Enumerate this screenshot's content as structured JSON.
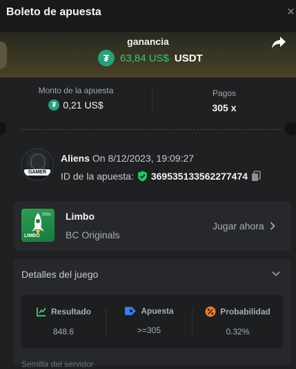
{
  "header": {
    "title": "Boleto de apuesta",
    "close_symbol": "×"
  },
  "hero": {
    "label": "ganancia",
    "amount": "63,84 US$",
    "currency": "USDT",
    "coin_color": "#26a17b",
    "amount_color": "#2fc97b"
  },
  "stats": {
    "bet_amount_label": "Monto de la apuesta",
    "bet_amount_value": "0,21 US$",
    "payout_label": "Pagos",
    "payout_value": "305 x"
  },
  "player": {
    "name": "Aliens",
    "date": "On 8/12/2023, 19:09:27",
    "bet_id_label": "ID de la apuesta:",
    "bet_id": "369535133562277474",
    "avatar_tag": "GAMER"
  },
  "game": {
    "title": "Limbo",
    "provider": "BC Originals",
    "play_label": "Jugar ahora",
    "thumb_text": "LIMBO",
    "thumb_badge": "300x"
  },
  "details": {
    "title": "Detalles del juego",
    "columns": [
      {
        "label": "Resultado",
        "value": "848.6",
        "icon": "result-chart-icon"
      },
      {
        "label": "Apuesta",
        "value": ">=305",
        "icon": "bet-tag-icon"
      },
      {
        "label": "Probabilidad",
        "value": "0.32%",
        "icon": "percent-icon"
      }
    ]
  },
  "footer_peek": "Semilla del servidor"
}
